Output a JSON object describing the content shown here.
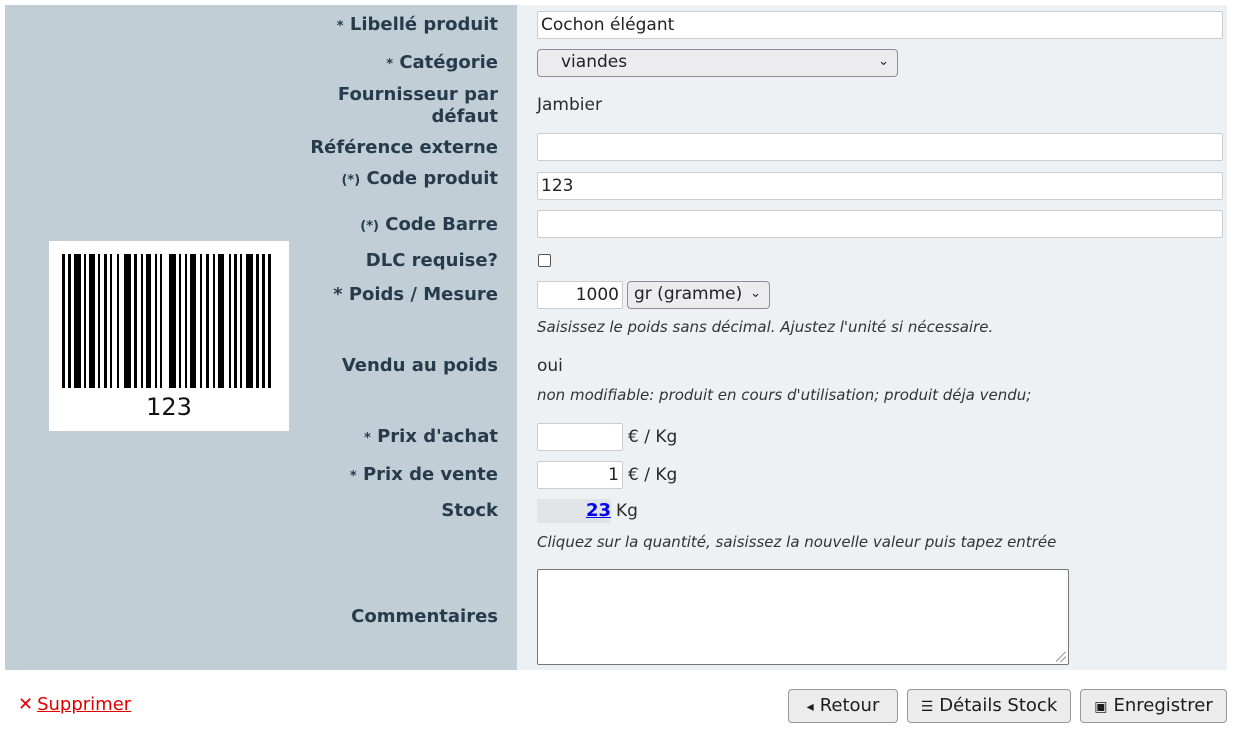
{
  "form": {
    "libelle": {
      "label": "Libellé produit",
      "required": "*",
      "value": "Cochon élégant"
    },
    "categorie": {
      "label": "Catégorie",
      "required": "*",
      "value": "viandes"
    },
    "fournisseur": {
      "label_line1": "Fournisseur par",
      "label_line2": "défaut",
      "value": "Jambier"
    },
    "reference": {
      "label": "Référence externe",
      "value": ""
    },
    "code_produit": {
      "label": "Code produit",
      "required": "(*)",
      "value": "123"
    },
    "code_barre": {
      "label": "Code Barre",
      "required": "(*)",
      "value": ""
    },
    "dlc": {
      "label": "DLC requise?",
      "checked": false
    },
    "poids": {
      "label": "* Poids / Mesure",
      "value": "1000",
      "unit": "gr (gramme)",
      "hint": "Saisissez le poids sans décimal. Ajustez l'unité si nécessaire."
    },
    "vendu_poids": {
      "label": "Vendu au poids",
      "value": "oui",
      "hint": "non modifiable: produit en cours d'utilisation; produit déja vendu;"
    },
    "prix_achat": {
      "label": "Prix d'achat",
      "required": "*",
      "value": "",
      "unit": "€ / Kg"
    },
    "prix_vente": {
      "label": "Prix de vente",
      "required": "*",
      "value": "1",
      "unit": "€ / Kg"
    },
    "stock": {
      "label": "Stock",
      "value": "23",
      "unit": "Kg",
      "hint": "Cliquez sur la quantité, saisissez la nouvelle valeur puis tapez entrée"
    },
    "commentaires": {
      "label": "Commentaires",
      "value": ""
    }
  },
  "barcode": {
    "number": "123"
  },
  "actions": {
    "delete": "Supprimer",
    "back": "Retour",
    "stock_details": "Détails Stock",
    "save": "Enregistrer"
  },
  "colors": {
    "left_panel": "#c1ced6",
    "right_panel": "#eef1f4",
    "delete": "#e00000",
    "link": "#0000ee"
  },
  "icons": {
    "delete": "x-icon",
    "back": "caret-left-icon",
    "stock": "list-icon",
    "save": "floppy-disk-icon"
  }
}
